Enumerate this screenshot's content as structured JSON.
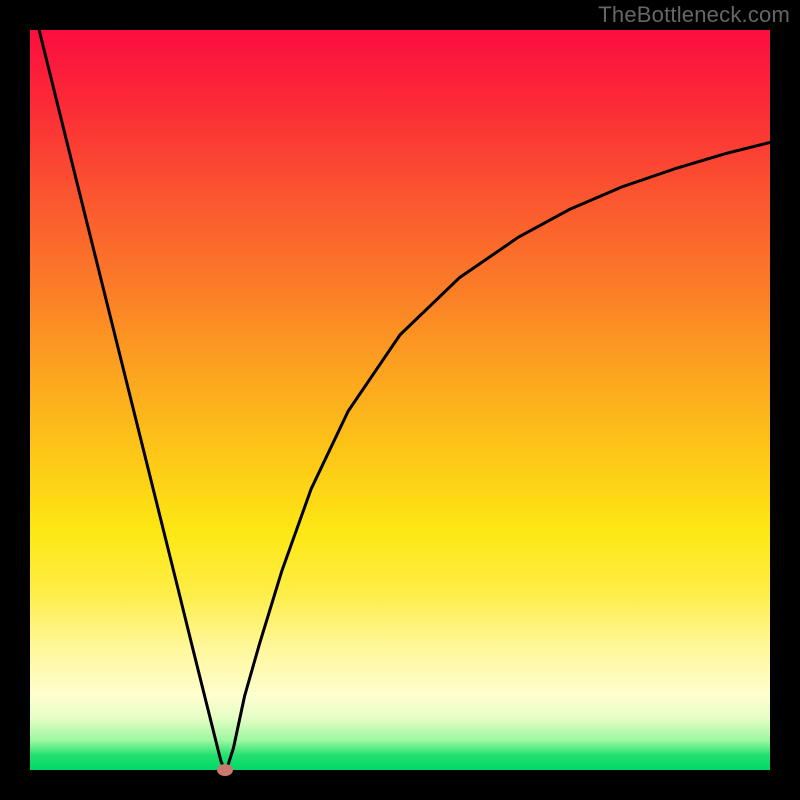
{
  "watermark": "TheBottleneck.com",
  "chart_data": {
    "type": "line",
    "title": "",
    "xlabel": "",
    "ylabel": "",
    "xlim": [
      0,
      1
    ],
    "ylim": [
      0,
      1
    ],
    "grid": false,
    "series": [
      {
        "name": "bottleneck-curve",
        "x": [
          0.0,
          0.05,
          0.1,
          0.15,
          0.2,
          0.22,
          0.24,
          0.256,
          0.258,
          0.262,
          0.263,
          0.264,
          0.268,
          0.275,
          0.29,
          0.31,
          0.34,
          0.38,
          0.43,
          0.5,
          0.58,
          0.66,
          0.73,
          0.8,
          0.87,
          0.94,
          1.0
        ],
        "values": [
          1.05,
          0.848,
          0.647,
          0.446,
          0.245,
          0.164,
          0.084,
          0.02,
          0.012,
          0.003,
          0.001,
          0.0,
          0.008,
          0.03,
          0.1,
          0.17,
          0.268,
          0.38,
          0.485,
          0.588,
          0.665,
          0.72,
          0.758,
          0.788,
          0.812,
          0.833,
          0.848
        ]
      }
    ],
    "annotations": [
      {
        "name": "min-point",
        "x": 0.264,
        "y": 0.0,
        "color": "#c9796d"
      }
    ],
    "background_gradient": {
      "direction": "vertical",
      "stops": [
        {
          "pos": 0.0,
          "color": "#fb0e3f"
        },
        {
          "pos": 0.46,
          "color": "#fca31f"
        },
        {
          "pos": 0.68,
          "color": "#fde814"
        },
        {
          "pos": 0.9,
          "color": "#fffed0"
        },
        {
          "pos": 1.0,
          "color": "#00d964"
        }
      ]
    }
  }
}
